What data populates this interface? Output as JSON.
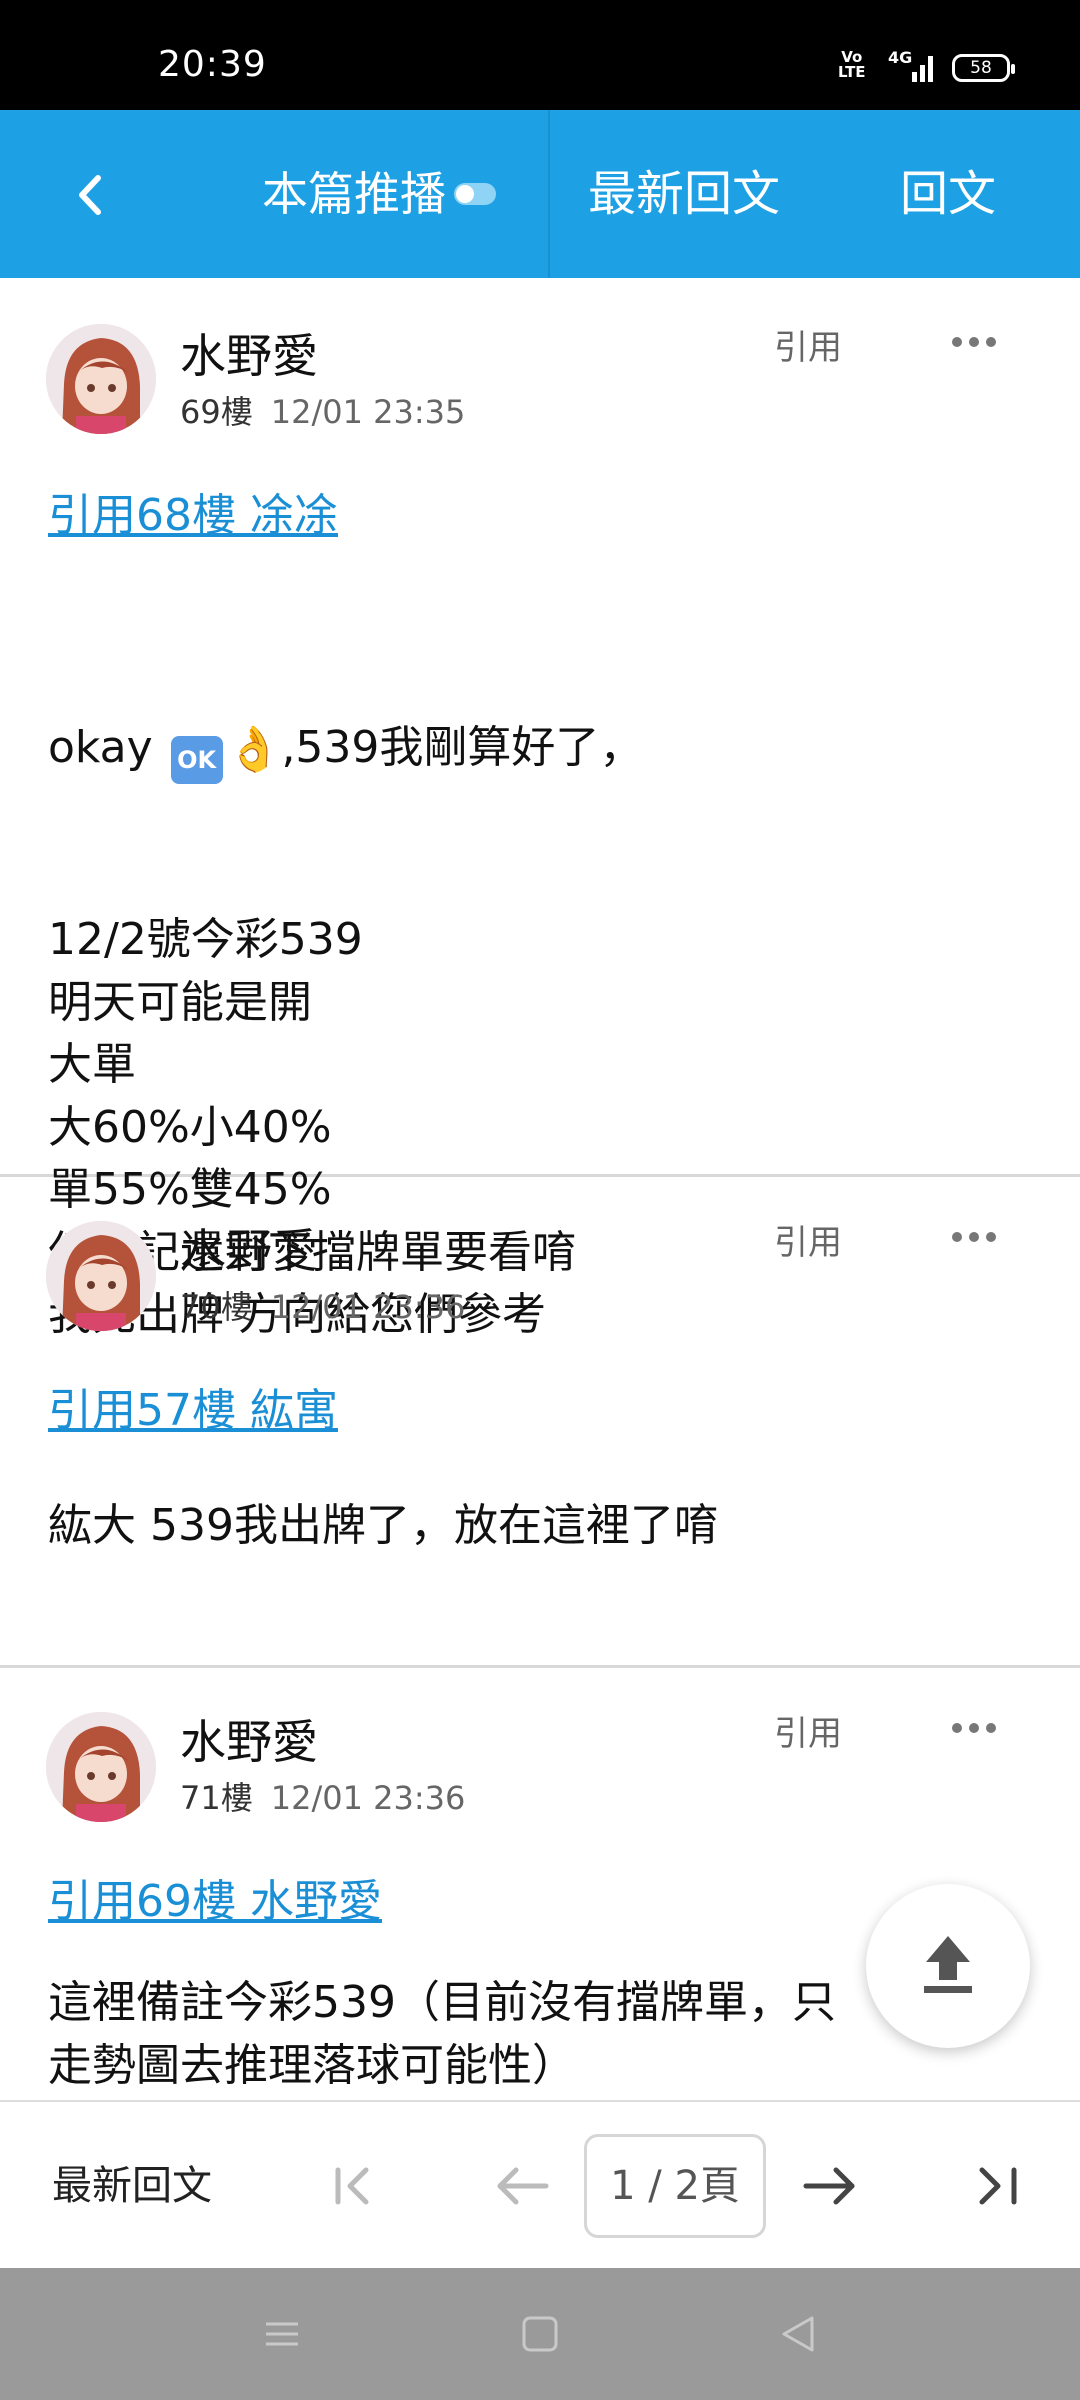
{
  "status_bar": {
    "time": "20:39",
    "volte": "Vo LTE",
    "network": "4G",
    "battery": "58"
  },
  "nav": {
    "back_icon": "chevron-left-icon",
    "push_tab": "本篇推播",
    "latest_tab": "最新回文",
    "reply_tab": "回文",
    "bar_color": "#1da1e4"
  },
  "posts": [
    {
      "author": "水野愛",
      "floor": "69樓",
      "date": "12/01 23:35",
      "quote_button": "引用",
      "quote_link": "引用68樓 凃凃",
      "content_first_line_text": "okay",
      "content_first_line_rest": ",539我剛算好了，",
      "content_lines": "12/2號今彩539\n明天可能是開\n大單\n大60%小40%\n單55%雙45%\n但切記還剩下擋牌單要看唷\n我先出牌 方向給您們參考"
    },
    {
      "author": "水野愛",
      "floor": "70樓",
      "date": "12/01 23:36",
      "quote_button": "引用",
      "quote_link": "引用57樓 紘寓",
      "content": "紘大 539我出牌了，放在這裡了唷"
    },
    {
      "author": "水野愛",
      "floor": "71樓",
      "date": "12/01 23:36",
      "quote_button": "引用",
      "quote_link": "引用69樓 水野愛",
      "content": "這裡備註今彩539（目前沒有擋牌單，只\n走勢圖去推理落球可能性）"
    }
  ],
  "emoji": {
    "ok_text": "OK"
  },
  "pager": {
    "latest_label": "最新回文",
    "page_indicator": "1 / 2頁"
  },
  "colors": {
    "accent": "#1da1e4",
    "link": "#1b8fd6"
  }
}
